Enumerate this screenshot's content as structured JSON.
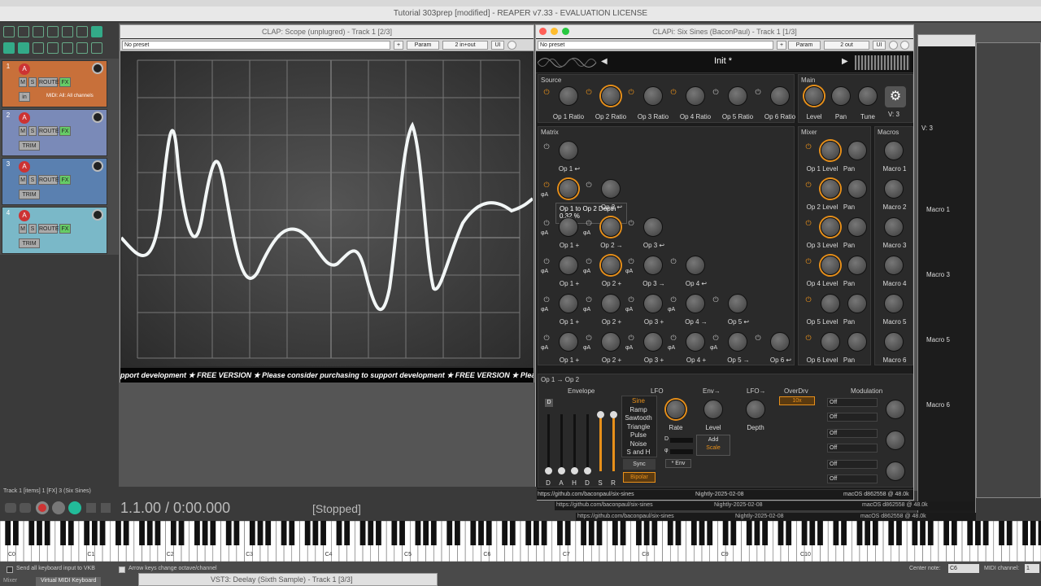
{
  "reaper": {
    "title": "Tutorial 303prep [modified] - REAPER v7.33 - EVALUATION LICENSE",
    "track_info": "Track 1 [items] 1 [FX] 3 (Six Sines)",
    "time": "1.1.00 / 0:00.000",
    "status": "[Stopped]",
    "midi_input": "MIDI: All: All channels",
    "track_btn_m": "M",
    "track_btn_s": "S",
    "track_btn_route": "ROUTE",
    "track_btn_fx": "FX",
    "track_btn_trim": "TRIM",
    "track_nums": [
      "1",
      "2",
      "3",
      "4"
    ],
    "track_in": "in",
    "track_letter": "A"
  },
  "scope": {
    "title": "CLAP: Scope (unplugred) - Track 1 [2/3]",
    "preset": "No preset",
    "plus": "+",
    "param_btn": "Param",
    "io_btn": "2 in+out",
    "ui_btn": "UI",
    "ticker": "pport development ★ FREE VERSION ★ Please consider purchasing to support development ★ FREE VERSION ★ Please consider"
  },
  "sixsines": {
    "title": "CLAPi: Six Sines (BaconPaul) - Track 1 [1/3]",
    "preset": "No preset",
    "plus": "+",
    "param_btn": "Param",
    "io_btn": "2 out",
    "ui_btn": "UI",
    "patch_name": "Init *",
    "source_label": "Source",
    "source_knobs": [
      "Op 1 Ratio",
      "Op 2 Ratio",
      "Op 3 Ratio",
      "Op 4 Ratio",
      "Op 5 Ratio",
      "Op 6 Ratio"
    ],
    "main_label": "Main",
    "main_knobs": [
      "Level",
      "Pan",
      "Tune"
    ],
    "version": "V: 3",
    "matrix_label": "Matrix",
    "mixer_label": "Mixer",
    "macros_label": "Macros",
    "mixer_rows": [
      {
        "level": "Op 1 Level",
        "pan": "Pan"
      },
      {
        "level": "Op 2 Level",
        "pan": "Pan"
      },
      {
        "level": "Op 3 Level",
        "pan": "Pan"
      },
      {
        "level": "Op 4 Level",
        "pan": "Pan"
      },
      {
        "level": "Op 5 Level",
        "pan": "Pan"
      },
      {
        "level": "Op 6 Level",
        "pan": "Pan"
      }
    ],
    "macros": [
      "Macro 1",
      "Macro 2",
      "Macro 3",
      "Macro 4",
      "Macro 5",
      "Macro 6"
    ],
    "matrix_rows": [
      [
        "Op 1 ↩"
      ],
      [
        "",
        "Op 2 ↩"
      ],
      [
        "Op 1 +",
        "Op 2 →",
        "Op 3 ↩"
      ],
      [
        "Op 1 +",
        "Op 2 +",
        "Op 3 →",
        "Op 4 ↩"
      ],
      [
        "Op 1 +",
        "Op 2 +",
        "Op 3 +",
        "Op 4 →",
        "Op 5 ↩"
      ],
      [
        "Op 1 +",
        "Op 2 +",
        "Op 3 +",
        "Op 4 +",
        "Op 5 →",
        "Op 6 ↩"
      ]
    ],
    "tooltip_title": "Op 1 to Op 2 Depth",
    "tooltip_value": "0.32 %",
    "edit_label": "Op 1 → Op 2",
    "envelope_label": "Envelope",
    "env_sliders": [
      "D",
      "A",
      "H",
      "D",
      "S",
      "R"
    ],
    "env_d": "D",
    "lfo_label": "LFO",
    "lfo_shapes": [
      "Sine",
      "Ramp",
      "Sawtooth",
      "Triangle",
      "Pulse",
      "Noise",
      "S and H"
    ],
    "sync_btn": "Sync",
    "bipolar_btn": "Bipolar",
    "rate_label": "Rate",
    "env_arrow_label": "Env→",
    "level_label": "Level",
    "lfo_arrow_label": "LFO→",
    "depth_label": "Depth",
    "lfo_d": "D",
    "lfo_phi": "φ",
    "env_mult": "* Env",
    "add_label": "Add",
    "scale_label": "Scale",
    "overdrv_label": "OverDrv",
    "overdrv_value": "10x",
    "modulation_label": "Modulation",
    "mod_values": [
      "Off",
      "Off",
      "Off",
      "Off",
      "Off",
      "Off"
    ],
    "footer_url": "https://github.com/baconpaul/six-sines",
    "footer_build": "Nightly-2025-02-08",
    "footer_os": "macOS d862558 @ 48.0k",
    "phi_a": "φA",
    "back_macro": "Macro",
    "back_v3": "V: 3"
  },
  "vst3": {
    "title": "VST3: Deelay (Sixth Sample) - Track 1 [3/3]"
  },
  "vkb": {
    "send_all": "Send all keyboard input to VKB",
    "arrow_keys": "Arrow keys change octave/channel",
    "center_note_label": "Center note:",
    "center_note": "C6",
    "midi_channel_label": "MIDI channel:",
    "midi_channel": "1",
    "tab_mixer": "Mixer",
    "tab_vkb": "Virtual MIDI Keyboard",
    "octaves": [
      "C0",
      "C1",
      "C2",
      "C3",
      "C4",
      "C5",
      "C6",
      "C7",
      "C8",
      "C9",
      "C10"
    ]
  },
  "colors": {
    "accent": "#e8901a",
    "track1": "#c8703a",
    "track2": "#7a8ab8",
    "track3": "#5a80b0",
    "track4": "#7ab8c8"
  }
}
